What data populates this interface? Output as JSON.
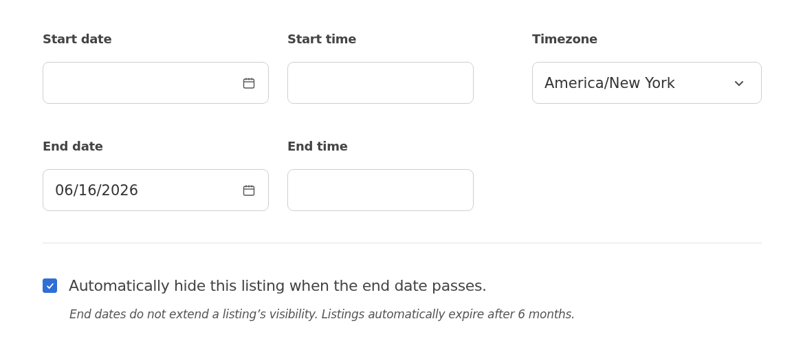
{
  "rows": [
    [
      {
        "kind": "date",
        "label": "Start date"
      },
      {
        "kind": "time",
        "label": "Start time"
      },
      {
        "kind": "select",
        "label": "Timezone",
        "value": "America/New York"
      }
    ],
    [
      {
        "kind": "date",
        "label": "End date",
        "value": "06/16/2026"
      },
      {
        "kind": "time",
        "label": "End time"
      }
    ]
  ],
  "auto_hide": {
    "checked": true,
    "label": "Automatically hide this listing when the end date passes.",
    "hint": "End dates do not extend a listing’s visibility. Listings automatically expire after 6 months."
  }
}
